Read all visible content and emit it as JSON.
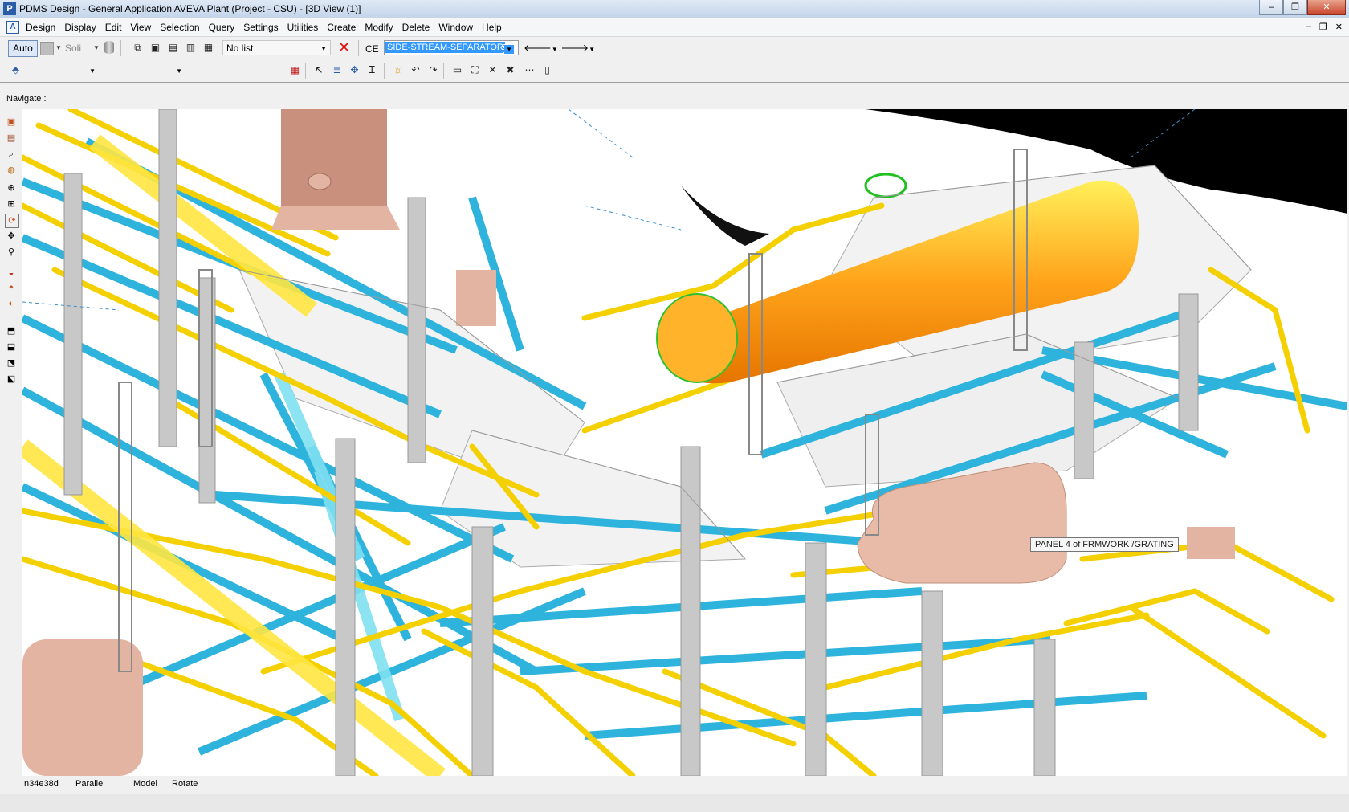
{
  "window": {
    "title": "PDMS Design - General Application  AVEVA Plant (Project - CSU) - [3D View (1)]",
    "controls": {
      "minimize": "–",
      "restore": "❐",
      "close": "✕"
    }
  },
  "menubar": {
    "items": [
      "Design",
      "Display",
      "Edit",
      "View",
      "Selection",
      "Query",
      "Settings",
      "Utilities",
      "Create",
      "Modify",
      "Delete",
      "Window",
      "Help"
    ],
    "mdi_controls": {
      "minimize": "–",
      "restore": "❐",
      "close": "✕"
    }
  },
  "toolbar": {
    "auto_label": "Auto",
    "render_mode": "Soli",
    "list_select": "No list",
    "ce_label": "CE",
    "ce_value": "SIDE-STREAM-SEPARATOR"
  },
  "navigate_label": "Navigate :",
  "viewport": {
    "tooltip": "PANEL 4 of FRMWORK /GRATING"
  },
  "status": {
    "direction": "n34e38d",
    "projection": "Parallel",
    "mode": "Model",
    "action": "Rotate"
  },
  "colors": {
    "steel": "#2db3dc",
    "pipe": "#f5d000",
    "vessel": "#ffa31a",
    "equipment": "#e3b4a2",
    "concrete": "#c8c8c8",
    "grating": "#f2f2f2"
  }
}
